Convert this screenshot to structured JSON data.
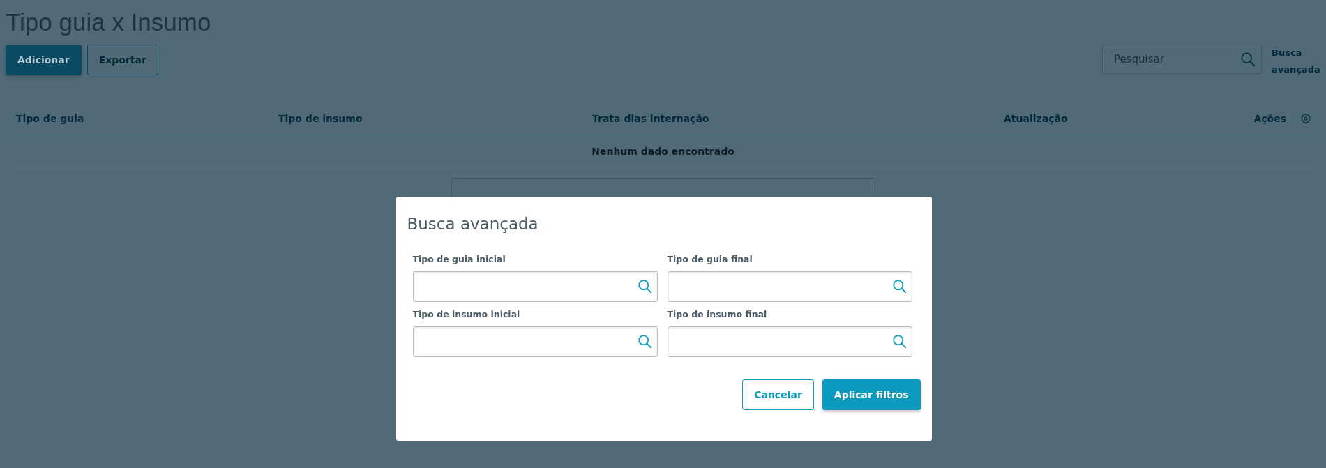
{
  "page": {
    "title": "Tipo guia x Insumo"
  },
  "actions": [
    {
      "label": "Adicionar",
      "kind": "primary"
    },
    {
      "label": "Exportar",
      "kind": "secondary"
    }
  ],
  "search": {
    "placeholder": "Pesquisar"
  },
  "advanced_search_link": "Busca avançada",
  "table": {
    "columns": [
      "Tipo de guia",
      "Tipo de insumo",
      "Trata dias internação",
      "Atualização",
      "Ações"
    ],
    "empty_message": "Nenhum dado encontrado"
  },
  "modal": {
    "title": "Busca avançada",
    "fields": [
      {
        "label": "Tipo de guia inicial"
      },
      {
        "label": "Tipo de guia final"
      },
      {
        "label": "Tipo de insumo inicial"
      },
      {
        "label": "Tipo de insumo final"
      }
    ],
    "buttons": [
      {
        "label": "Cancelar",
        "kind": "secondary"
      },
      {
        "label": "Aplicar filtros",
        "kind": "primary"
      }
    ]
  }
}
